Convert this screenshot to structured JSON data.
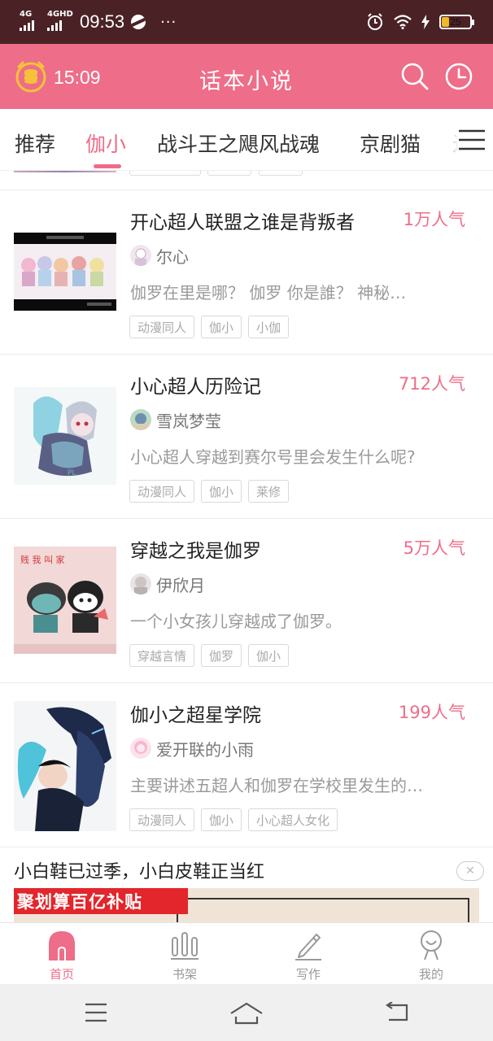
{
  "status_bar": {
    "signal1": "4G",
    "signal2": "4GHD",
    "time": "09:53",
    "more": "···",
    "battery": "25",
    "battery_level": 0.25
  },
  "header": {
    "time": "15:09",
    "title": "话本小说",
    "icons": [
      "coin-clock-icon",
      "search-icon",
      "history-icon"
    ]
  },
  "tabs": [
    {
      "label": "推荐",
      "active": false
    },
    {
      "label": "伽小",
      "active": true
    },
    {
      "label": "战斗王之飓风战魂",
      "active": false
    },
    {
      "label": "京剧猫",
      "active": false
    },
    {
      "label": "进",
      "active": false
    }
  ],
  "books": [
    {
      "title": "开心超人联盟之谁是背叛者",
      "popularity": "1万人气",
      "author": "尔心",
      "description": "伽罗在里是哪？ 伽罗 你是誰？ 神秘…",
      "tags": [
        "动漫同人",
        "伽小",
        "小伽"
      ]
    },
    {
      "title": "小心超人历险记",
      "popularity": "712人气",
      "author": "雪岚梦莹",
      "description": "小心超人穿越到赛尔号里会发生什么呢?",
      "tags": [
        "动漫同人",
        "伽小",
        "莱修"
      ]
    },
    {
      "title": "穿越之我是伽罗",
      "popularity": "5万人气",
      "author": "伊欣月",
      "description": "一个小女孩儿穿越成了伽罗。",
      "tags": [
        "穿越言情",
        "伽罗",
        "伽小"
      ]
    },
    {
      "title": "伽小之超星学院",
      "popularity": "199人气",
      "author": "爱开联的小雨",
      "description": "主要讲述五超人和伽罗在学校里发生的…",
      "tags": [
        "动漫同人",
        "伽小",
        "小心超人女化"
      ]
    }
  ],
  "ad": {
    "title": "小白鞋已过季，小白皮鞋正当红",
    "close": "✕",
    "banner_text": "聚划算百亿补贴"
  },
  "bottom_nav": [
    {
      "label": "首页",
      "icon": "home-icon",
      "active": true
    },
    {
      "label": "书架",
      "icon": "bookshelf-icon",
      "active": false
    },
    {
      "label": "写作",
      "icon": "pencil-icon",
      "active": false
    },
    {
      "label": "我的",
      "icon": "profile-icon",
      "active": false
    }
  ],
  "colors": {
    "brand": "#ee6d89",
    "status_bar": "#4a2226",
    "battery": "#f1b928"
  }
}
